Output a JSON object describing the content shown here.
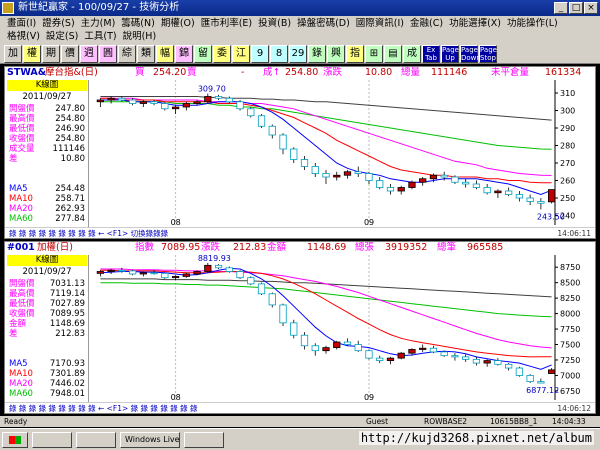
{
  "window": {
    "title": "新世紀贏家 - 100/09/27 - 技術分析"
  },
  "menu_row1": [
    "畫面(I)",
    "證券(S)",
    "主力(M)",
    "籌碼(N)",
    "期權(O)",
    "匯市利率(E)",
    "投資(B)",
    "操盤密碼(D)",
    "國際資訊(I)",
    "金融(C)",
    "功能選擇(X)",
    "功能操作(L)"
  ],
  "menu_row2": [
    "格視(V)",
    "設定(S)",
    "工具(T)",
    "說明(H)"
  ],
  "toolbar": [
    "加",
    "權",
    "期",
    "價",
    "週",
    "圓",
    "綜",
    "類",
    "幅",
    "錦",
    "留",
    "委",
    "江",
    "9",
    "8",
    "29",
    "錄",
    "興",
    "指",
    "⊞",
    "▤",
    "成",
    "Ex Tab",
    "Page Up",
    "Page Down",
    "Page Stop"
  ],
  "panel1": {
    "header": {
      "code": "STWA&",
      "name": "摩台指&(日)",
      "buy_label": "買",
      "buy": "254.20",
      "sell_label": "賣",
      "change_sign": "-",
      "change_label": "成↑",
      "last": "254.80",
      "chg_label": "漲跌",
      "chg": "10.80",
      "vol_label": "總量",
      "vol": "111146",
      "oi_label": "未平倉量",
      "oi": "161334"
    },
    "tag": "K線圖",
    "date": "2011/09/27",
    "stats": [
      {
        "label": "開盤價",
        "value": "247.80"
      },
      {
        "label": "最高價",
        "value": "254.80"
      },
      {
        "label": "最低價",
        "value": "246.90"
      },
      {
        "label": "收盤價",
        "value": "254.80"
      },
      {
        "label": "成交量",
        "value": "111146"
      },
      {
        "label": "差",
        "value": "10.80"
      }
    ],
    "ma": [
      {
        "label": "MA5",
        "value": "254.48"
      },
      {
        "label": "MA10",
        "value": "258.71"
      },
      {
        "label": "MA20",
        "value": "262.93"
      },
      {
        "label": "MA60",
        "value": "277.84"
      }
    ],
    "foot_left": "錄 錄 錄 錄 錄 錄 錄 錄 錄 ← <F1> 切換錄錄錄",
    "foot_right": "14:06:11"
  },
  "panel2": {
    "header": {
      "code": "#001",
      "name": "加權(日)",
      "idx_label": "指數",
      "idx": "7089.95",
      "chg_label": "漲跌",
      "chg": "212.83",
      "amt_label": "金額",
      "amt": "1148.69",
      "vol_label": "總張",
      "vol": "3919352",
      "cnt_label": "總筆",
      "cnt": "965585"
    },
    "tag": "K線圖",
    "date": "2011/09/27",
    "stats": [
      {
        "label": "開盤價",
        "value": "7031.13"
      },
      {
        "label": "最高價",
        "value": "7119.14"
      },
      {
        "label": "最低價",
        "value": "7027.89"
      },
      {
        "label": "收盤價",
        "value": "7089.95"
      },
      {
        "label": "金額",
        "value": "1148.69"
      },
      {
        "label": "差",
        "value": "212.83"
      }
    ],
    "ma": [
      {
        "label": "MA5",
        "value": "7170.93"
      },
      {
        "label": "MA10",
        "value": "7301.89"
      },
      {
        "label": "MA20",
        "value": "7446.02"
      },
      {
        "label": "MA60",
        "value": "7948.01"
      }
    ],
    "foot_left": "錄 錄 錄 錄 錄 錄 錄 錄 錄 ← <F1> 錄 錄 錄 錄 錄 錄 錄",
    "foot_right": "14:06:12"
  },
  "status": {
    "ready": "Ready",
    "user": "Guest",
    "base": "ROWBASE2",
    "code": "10615BB8_1",
    "time": "14:04:33"
  },
  "taskbar": {
    "tasks": [
      "",
      "",
      "Windows Live",
      ""
    ],
    "watermark": "http://kujd3268.pixnet.net/album"
  },
  "colors": {
    "up": "#c00000",
    "down": "#00a0c0",
    "ma5": "#0000ff",
    "ma10": "#ff0000",
    "ma20": "#ff00ff",
    "ma60": "#00c000",
    "ma120": "#404040"
  },
  "chart_data": [
    {
      "type": "candlestick",
      "title": "摩台指&(日)",
      "x_labels": [
        "08",
        "09"
      ],
      "y_ticks": [
        240,
        250,
        260,
        270,
        280,
        290,
        300,
        310
      ],
      "ylim": [
        238,
        314
      ],
      "annotations": [
        {
          "text": "309.70"
        },
        {
          "text": "243.50"
        }
      ],
      "ohlc": [
        [
          305,
          307,
          302,
          306
        ],
        [
          306,
          308,
          304,
          307
        ],
        [
          307,
          308,
          305,
          306
        ],
        [
          306,
          307,
          303,
          304
        ],
        [
          304,
          306,
          302,
          305
        ],
        [
          305,
          306,
          303,
          304
        ],
        [
          304,
          305,
          300,
          301
        ],
        [
          301,
          303,
          298,
          302
        ],
        [
          302,
          305,
          300,
          304
        ],
        [
          304,
          306,
          303,
          305
        ],
        [
          305,
          309.7,
          304,
          308
        ],
        [
          308,
          309,
          306,
          307
        ],
        [
          307,
          308,
          304,
          305
        ],
        [
          305,
          306,
          300,
          301
        ],
        [
          301,
          302,
          296,
          297
        ],
        [
          297,
          298,
          290,
          291
        ],
        [
          291,
          292,
          284,
          286
        ],
        [
          286,
          287,
          275,
          278
        ],
        [
          278,
          279,
          270,
          272
        ],
        [
          272,
          274,
          266,
          268
        ],
        [
          268,
          270,
          262,
          264
        ],
        [
          264,
          266,
          258,
          262
        ],
        [
          262,
          265,
          260,
          263
        ],
        [
          263,
          266,
          261,
          265
        ],
        [
          265,
          268,
          262,
          264
        ],
        [
          264,
          265,
          258,
          260
        ],
        [
          260,
          262,
          255,
          256
        ],
        [
          256,
          258,
          252,
          254
        ],
        [
          254,
          257,
          252,
          256
        ],
        [
          256,
          260,
          255,
          259
        ],
        [
          259,
          262,
          257,
          261
        ],
        [
          261,
          264,
          259,
          263
        ],
        [
          263,
          265,
          260,
          262
        ],
        [
          262,
          263,
          258,
          259
        ],
        [
          259,
          261,
          256,
          258
        ],
        [
          258,
          260,
          255,
          256
        ],
        [
          256,
          258,
          252,
          253
        ],
        [
          253,
          255,
          250,
          254
        ],
        [
          254,
          256,
          251,
          252
        ],
        [
          252,
          254,
          248,
          250
        ],
        [
          250,
          252,
          246,
          248
        ],
        [
          248,
          250,
          243.5,
          247
        ],
        [
          247.8,
          254.8,
          246.9,
          254.8
        ]
      ],
      "ma5": [
        306,
        306,
        306,
        305,
        305,
        305,
        304,
        303,
        303,
        303,
        304,
        305,
        305,
        305,
        304,
        302,
        299,
        295,
        290,
        285,
        280,
        275,
        270,
        267,
        265,
        264,
        263,
        261,
        260,
        259,
        259,
        260,
        261,
        261,
        261,
        261,
        260,
        259,
        258,
        256,
        254,
        252,
        254.48
      ],
      "ma10": [
        307,
        307,
        306,
        306,
        306,
        306,
        305,
        305,
        305,
        305,
        305,
        304,
        304,
        304,
        303,
        302,
        300,
        298,
        296,
        293,
        290,
        287,
        283,
        280,
        277,
        274,
        271,
        268,
        266,
        265,
        264,
        263,
        263,
        262,
        262,
        262,
        261,
        261,
        260,
        260,
        259,
        258.7,
        258.71
      ],
      "ma20": [
        307,
        307,
        307,
        307,
        306,
        306,
        306,
        306,
        306,
        306,
        305,
        305,
        305,
        305,
        304,
        304,
        303,
        302,
        301,
        299,
        297,
        295,
        293,
        291,
        289,
        287,
        285,
        283,
        281,
        279,
        277,
        275,
        273,
        271,
        270,
        269,
        267,
        266,
        265,
        264,
        263.5,
        263,
        262.93
      ],
      "ma60": [
        305,
        305,
        305,
        305,
        305,
        305,
        305,
        304,
        304,
        304,
        304,
        303,
        303,
        302,
        302,
        301,
        301,
        300,
        299,
        298,
        297,
        296,
        295,
        294,
        293,
        292,
        291,
        290,
        289,
        288,
        287,
        286,
        285,
        284,
        283,
        282,
        281,
        280,
        279.5,
        279,
        278.5,
        278,
        277.84
      ],
      "ma120": [
        308,
        308,
        308,
        308,
        308,
        308,
        308,
        308,
        308,
        308,
        307.5,
        307.5,
        307,
        307,
        307,
        306.5,
        306.5,
        306,
        306,
        305.5,
        305,
        305,
        304.5,
        304,
        303.5,
        303,
        302.5,
        302,
        301.5,
        301,
        300.5,
        300,
        299.5,
        299,
        298.5,
        298,
        297.5,
        297,
        296.5,
        296,
        295.5,
        295,
        294.5
      ]
    },
    {
      "type": "candlestick",
      "title": "加權(日)",
      "x_labels": [
        "08",
        "09"
      ],
      "y_ticks": [
        6750,
        7000,
        7250,
        7500,
        7750,
        8000,
        8250,
        8500,
        8750
      ],
      "ylim": [
        6700,
        8850
      ],
      "annotations": [
        {
          "text": "8819.93"
        },
        {
          "text": "6877.12"
        }
      ],
      "ohlc": [
        [
          8650,
          8700,
          8600,
          8680
        ],
        [
          8680,
          8720,
          8640,
          8700
        ],
        [
          8700,
          8740,
          8660,
          8690
        ],
        [
          8690,
          8710,
          8620,
          8640
        ],
        [
          8640,
          8680,
          8600,
          8660
        ],
        [
          8660,
          8700,
          8630,
          8650
        ],
        [
          8650,
          8660,
          8560,
          8580
        ],
        [
          8580,
          8620,
          8540,
          8600
        ],
        [
          8600,
          8660,
          8580,
          8640
        ],
        [
          8640,
          8700,
          8620,
          8680
        ],
        [
          8680,
          8819.93,
          8660,
          8780
        ],
        [
          8780,
          8800,
          8720,
          8740
        ],
        [
          8740,
          8760,
          8660,
          8680
        ],
        [
          8680,
          8700,
          8560,
          8580
        ],
        [
          8580,
          8600,
          8460,
          8480
        ],
        [
          8480,
          8500,
          8300,
          8320
        ],
        [
          8320,
          8340,
          8100,
          8140
        ],
        [
          8140,
          8160,
          7800,
          7850
        ],
        [
          7850,
          7900,
          7600,
          7650
        ],
        [
          7650,
          7700,
          7420,
          7480
        ],
        [
          7480,
          7520,
          7320,
          7400
        ],
        [
          7400,
          7480,
          7350,
          7450
        ],
        [
          7450,
          7560,
          7420,
          7540
        ],
        [
          7540,
          7600,
          7480,
          7500
        ],
        [
          7500,
          7560,
          7380,
          7400
        ],
        [
          7400,
          7420,
          7260,
          7280
        ],
        [
          7280,
          7320,
          7200,
          7240
        ],
        [
          7240,
          7300,
          7180,
          7280
        ],
        [
          7280,
          7380,
          7260,
          7360
        ],
        [
          7360,
          7440,
          7320,
          7420
        ],
        [
          7420,
          7500,
          7380,
          7440
        ],
        [
          7440,
          7480,
          7360,
          7380
        ],
        [
          7380,
          7400,
          7300,
          7320
        ],
        [
          7320,
          7360,
          7240,
          7300
        ],
        [
          7300,
          7340,
          7220,
          7260
        ],
        [
          7260,
          7300,
          7160,
          7200
        ],
        [
          7200,
          7260,
          7140,
          7240
        ],
        [
          7240,
          7280,
          7160,
          7180
        ],
        [
          7180,
          7200,
          7080,
          7120
        ],
        [
          7120,
          7140,
          6980,
          7000
        ],
        [
          7000,
          7020,
          6877.12,
          6900
        ],
        [
          6900,
          6950,
          6880,
          6877.12
        ],
        [
          7031.13,
          7119.14,
          7027.89,
          7089.95
        ]
      ],
      "ma5": [
        8660,
        8670,
        8680,
        8680,
        8670,
        8670,
        8660,
        8640,
        8620,
        8630,
        8660,
        8700,
        8730,
        8720,
        8650,
        8560,
        8440,
        8290,
        8120,
        7950,
        7780,
        7640,
        7530,
        7480,
        7470,
        7450,
        7400,
        7350,
        7320,
        7330,
        7360,
        7380,
        7390,
        7380,
        7350,
        7300,
        7270,
        7240,
        7220,
        7200,
        7150,
        7100,
        7170.93
      ],
      "ma10": [
        8700,
        8700,
        8690,
        8690,
        8690,
        8690,
        8680,
        8670,
        8660,
        8660,
        8660,
        8670,
        8680,
        8680,
        8670,
        8650,
        8610,
        8560,
        8490,
        8410,
        8320,
        8220,
        8120,
        8020,
        7920,
        7830,
        7740,
        7660,
        7600,
        7560,
        7530,
        7500,
        7470,
        7440,
        7410,
        7380,
        7360,
        7340,
        7320,
        7310,
        7300,
        7302,
        7301.89
      ],
      "ma20": [
        8720,
        8720,
        8720,
        8710,
        8710,
        8710,
        8700,
        8700,
        8690,
        8690,
        8690,
        8680,
        8680,
        8670,
        8660,
        8650,
        8630,
        8610,
        8580,
        8550,
        8520,
        8480,
        8440,
        8390,
        8340,
        8280,
        8220,
        8160,
        8100,
        8040,
        7980,
        7920,
        7860,
        7800,
        7740,
        7680,
        7630,
        7580,
        7540,
        7510,
        7480,
        7460,
        7446.02
      ],
      "ma60": [
        8500,
        8500,
        8500,
        8490,
        8490,
        8490,
        8480,
        8480,
        8470,
        8470,
        8460,
        8460,
        8450,
        8440,
        8430,
        8420,
        8410,
        8400,
        8380,
        8360,
        8340,
        8320,
        8300,
        8280,
        8260,
        8240,
        8220,
        8200,
        8180,
        8160,
        8140,
        8120,
        8100,
        8080,
        8060,
        8040,
        8020,
        8000,
        7990,
        7975,
        7965,
        7955,
        7948.01
      ],
      "ma120": [
        8560,
        8560,
        8560,
        8560,
        8560,
        8560,
        8550,
        8550,
        8550,
        8550,
        8540,
        8540,
        8540,
        8530,
        8530,
        8520,
        8520,
        8510,
        8500,
        8500,
        8490,
        8480,
        8470,
        8460,
        8450,
        8440,
        8430,
        8420,
        8410,
        8400,
        8390,
        8380,
        8370,
        8360,
        8350,
        8340,
        8330,
        8320,
        8310,
        8300,
        8290,
        8280,
        8270
      ]
    }
  ]
}
